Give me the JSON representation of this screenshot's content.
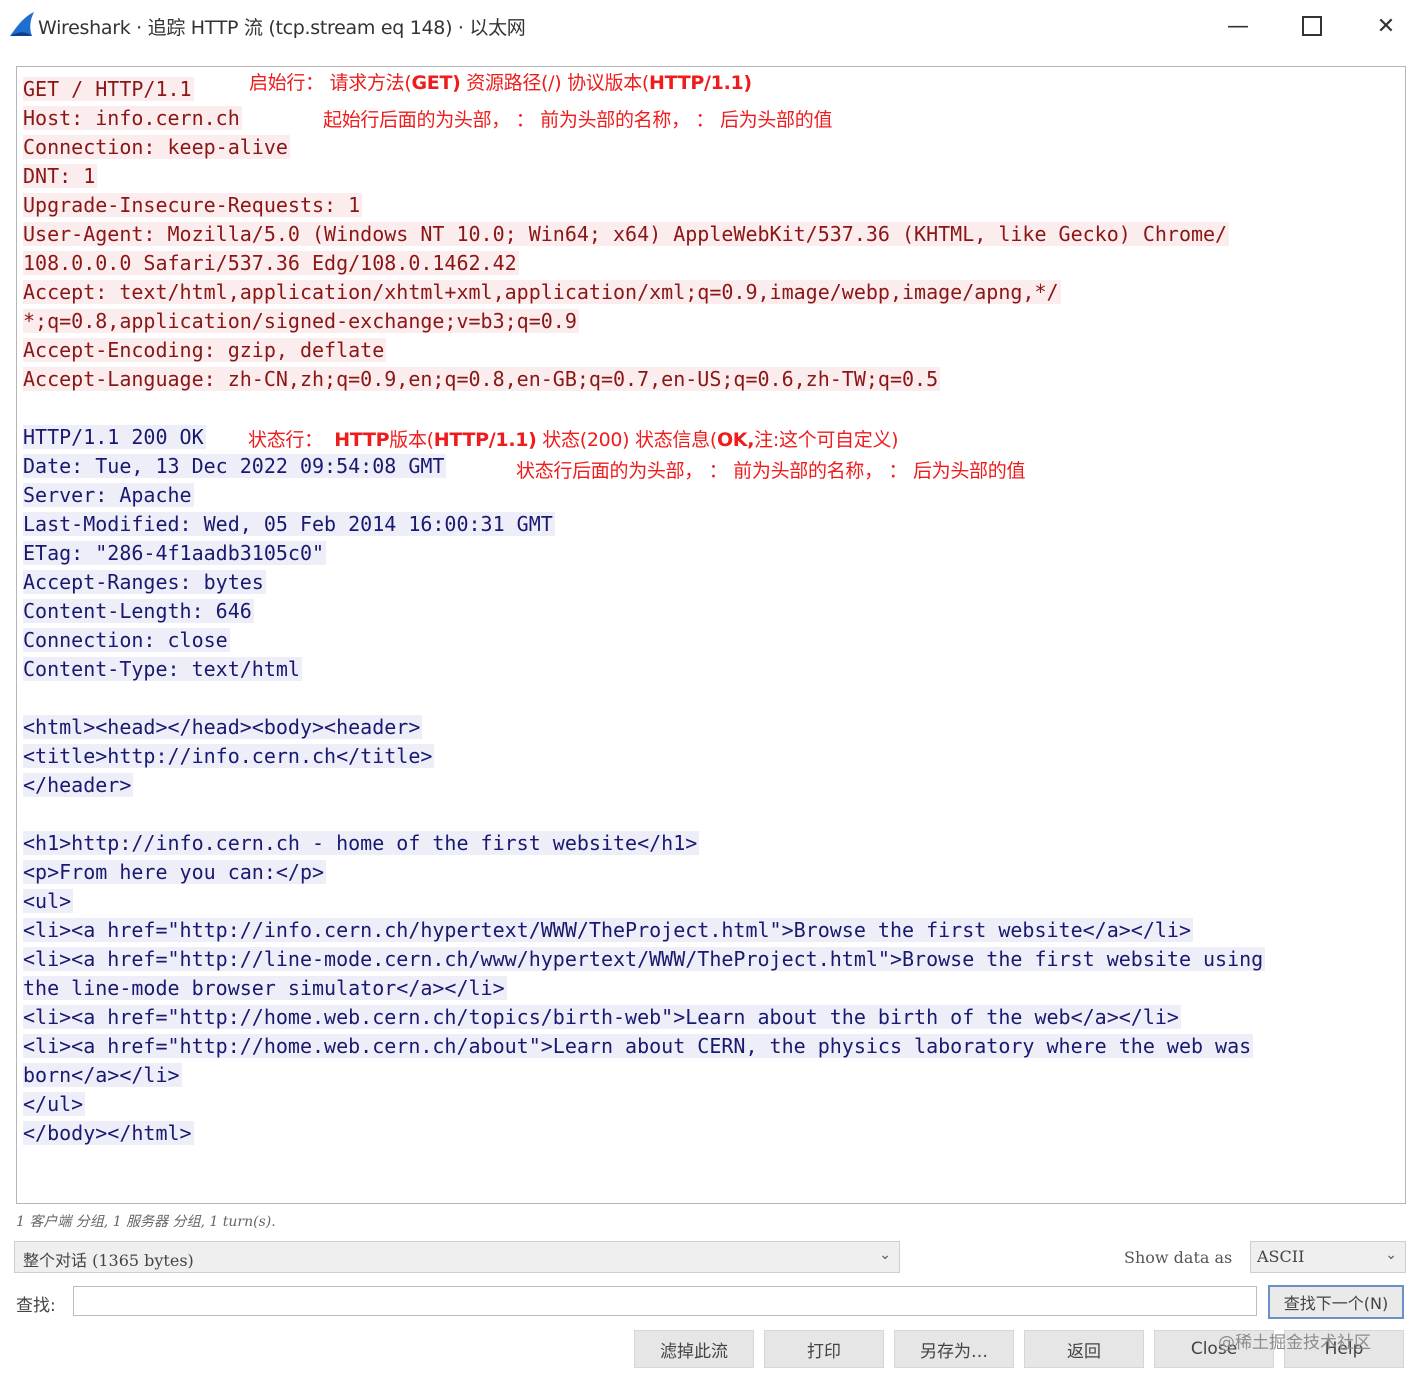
{
  "window": {
    "title": "Wireshark · 追踪 HTTP 流 (tcp.stream eq 148) · 以太网",
    "minimize": "—",
    "close": "✕"
  },
  "stream": {
    "client_lines": [
      "GET / HTTP/1.1",
      "Host: info.cern.ch",
      "Connection: keep-alive",
      "DNT: 1",
      "Upgrade-Insecure-Requests: 1",
      "User-Agent: Mozilla/5.0 (Windows NT 10.0; Win64; x64) AppleWebKit/537.36 (KHTML, like Gecko) Chrome/",
      "108.0.0.0 Safari/537.36 Edg/108.0.1462.42",
      "Accept: text/html,application/xhtml+xml,application/xml;q=0.9,image/webp,image/apng,*/",
      "*;q=0.8,application/signed-exchange;v=b3;q=0.9",
      "Accept-Encoding: gzip, deflate",
      "Accept-Language: zh-CN,zh;q=0.9,en;q=0.8,en-GB;q=0.7,en-US;q=0.6,zh-TW;q=0.5"
    ],
    "server_lines": [
      "HTTP/1.1 200 OK",
      "Date: Tue, 13 Dec 2022 09:54:08 GMT",
      "Server: Apache",
      "Last-Modified: Wed, 05 Feb 2014 16:00:31 GMT",
      "ETag: \"286-4f1aadb3105c0\"",
      "Accept-Ranges: bytes",
      "Content-Length: 646",
      "Connection: close",
      "Content-Type: text/html",
      "",
      "<html><head></head><body><header>",
      "<title>http://info.cern.ch</title>",
      "</header>",
      "",
      "<h1>http://info.cern.ch - home of the first website</h1>",
      "<p>From here you can:</p>",
      "<ul>",
      "<li><a href=\"http://info.cern.ch/hypertext/WWW/TheProject.html\">Browse the first website</a></li>",
      "<li><a href=\"http://line-mode.cern.ch/www/hypertext/WWW/TheProject.html\">Browse the first website using",
      "the line-mode browser simulator</a></li>",
      "<li><a href=\"http://home.web.cern.ch/topics/birth-web\">Learn about the birth of the web</a></li>",
      "<li><a href=\"http://home.web.cern.ch/about\">Learn about CERN, the physics laboratory where the web was",
      "born</a></li>",
      "</ul>",
      "</body></html>"
    ]
  },
  "annotations": {
    "request_line": {
      "label": "启始行：",
      "p1": " 请求方法(",
      "b1": "GET)",
      "p2": " 资源路径(/) 协议版本(",
      "b2": "HTTP/1.1)"
    },
    "request_headers": "起始行后面的为头部， ：  前为头部的名称， ：  后为头部的值",
    "status_line": {
      "label": "状态行：",
      "b1": "HTTP",
      "p1": "版本(",
      "b2": "HTTP/1.1)",
      "p2": " 状态(200) 状态信息(",
      "b3": "OK,",
      "p3": "注:这个可自定义)"
    },
    "response_headers": "状态行后面的为头部， ：  前为头部的名称， ：  后为头部的值"
  },
  "status_bar": {
    "stats": "1 客户端 分组, 1 服务器 分组, 1 turn(s)."
  },
  "controls": {
    "conversation_select": "整个对话 (1365 bytes)",
    "show_data_label": "Show data as",
    "format_select": "ASCII",
    "find_label": "查找:",
    "find_placeholder": "",
    "find_next": "查找下一个(N)"
  },
  "buttons": {
    "filter_out": "滤掉此流",
    "print": "打印",
    "save_as": "另存为…",
    "back": "返回",
    "close": "Close",
    "help": "Help"
  },
  "watermark": "@稀土掘金技术社区",
  "colors": {
    "client_text": "#8a1616",
    "client_bg": "#fbeded",
    "server_text": "#191970",
    "server_bg": "#eeeef9",
    "annotation": "#ee1c1c"
  }
}
